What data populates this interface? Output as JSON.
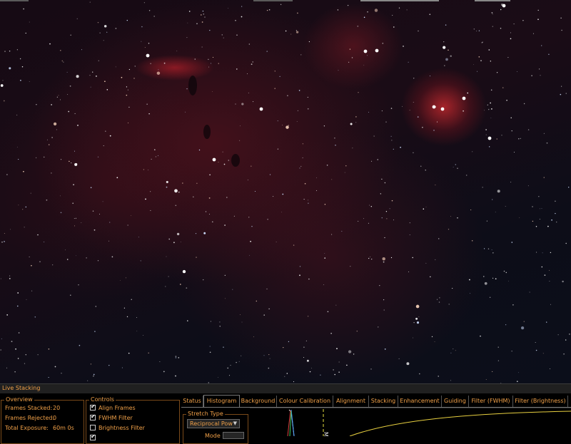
{
  "panel": {
    "title": "Live Stacking"
  },
  "overview": {
    "legend": "Overview",
    "frames_stacked_label": "Frames Stacked:",
    "frames_stacked_value": "20",
    "frames_rejected_label": "Frames Rejected:",
    "frames_rejected_value": "0",
    "total_exposure_label": "Total Exposure:",
    "total_exposure_value": "60m 0s"
  },
  "controls": {
    "legend": "Controls",
    "items": [
      {
        "label": "Align Frames",
        "checked": true
      },
      {
        "label": "FWHM Filter",
        "checked": true
      },
      {
        "label": "Brightness Filter",
        "checked": false
      }
    ]
  },
  "tabs": [
    {
      "label": "Status",
      "active": false
    },
    {
      "label": "Histogram",
      "active": true
    },
    {
      "label": "Background",
      "active": false
    },
    {
      "label": "Colour Calibration",
      "active": false
    },
    {
      "label": "Alignment",
      "active": false
    },
    {
      "label": "Stacking",
      "active": false
    },
    {
      "label": "Enhancement",
      "active": false
    },
    {
      "label": "Guiding",
      "active": false
    },
    {
      "label": "Filter (FWHM)",
      "active": false
    },
    {
      "label": "Filter (Brightness)",
      "active": false
    }
  ],
  "histogram": {
    "stretch_legend": "Stretch Type",
    "stretch_value": "Reciprocal Pow",
    "mode_label": "Mode",
    "marker_label": "M"
  },
  "colors": {
    "accent": "#f0a048",
    "panel_bg": "#000000",
    "border": "#7a4a1a",
    "curve": "#e8d040"
  },
  "icons": {
    "dropdown": "chevron-down-icon",
    "checkbox": "checkbox-icon"
  }
}
